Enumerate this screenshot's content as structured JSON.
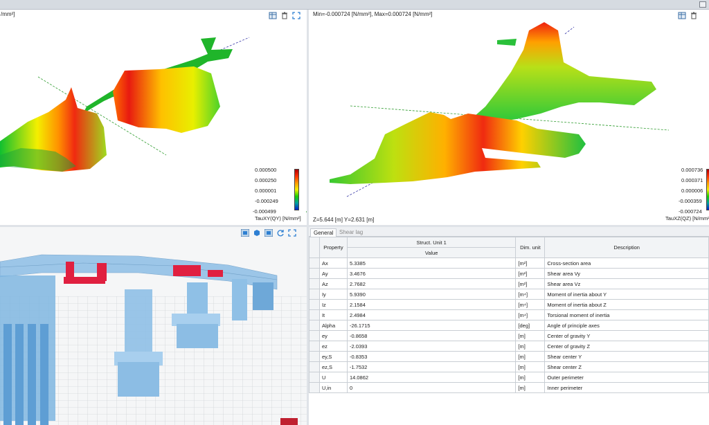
{
  "top_left": {
    "header_partial": "/mm²]",
    "legend": {
      "values": [
        "0.000500",
        "0.000250",
        "0.000001",
        "-0.000249",
        "-0.000499"
      ],
      "title": "TauXY(QY) [N/mm²]"
    }
  },
  "top_right": {
    "minmax": "Min=-0.000724 [N/mm²], Max=0.000724 [N/mm²]",
    "coords": "Z=5.644 [m] Y=2.631 [m]",
    "legend": {
      "values": [
        "0.000736",
        "0.000371",
        "0.000006",
        "-0.000359",
        "-0.000724"
      ],
      "title": "TauXZ(QZ) [N/mm²"
    }
  },
  "tabs": [
    "General",
    "Shear lag"
  ],
  "table": {
    "col_property": "Property",
    "col_unit_group": "Struct. Unit 1",
    "col_value": "Value",
    "col_dim": "Dim. unit",
    "col_desc": "Description",
    "rows": [
      {
        "p": "Ax",
        "v": "5.3385",
        "u": "[m²]",
        "d": "Cross-section area"
      },
      {
        "p": "Ay",
        "v": "3.4676",
        "u": "[m²]",
        "d": "Shear area Vy"
      },
      {
        "p": "Az",
        "v": "2.7682",
        "u": "[m²]",
        "d": "Shear area Vz"
      },
      {
        "p": "Iy",
        "v": "5.9390",
        "u": "[m⁴]",
        "d": "Moment of inertia about Y"
      },
      {
        "p": "Iz",
        "v": "2.1584",
        "u": "[m⁴]",
        "d": "Moment of inertia about Z"
      },
      {
        "p": "It",
        "v": "2.4984",
        "u": "[m⁴]",
        "d": "Torsional moment of inertia"
      },
      {
        "p": "Alpha",
        "v": "-26.1715",
        "u": "[deg]",
        "d": "Angle of principle axes"
      },
      {
        "p": "ey",
        "v": "-0.8658",
        "u": "[m]",
        "d": "Center of gravity Y"
      },
      {
        "p": "ez",
        "v": "-2.0393",
        "u": "[m]",
        "d": "Center of gravity Z"
      },
      {
        "p": "ey,S",
        "v": "-0.8353",
        "u": "[m]",
        "d": "Shear center Y"
      },
      {
        "p": "ez,S",
        "v": "-1.7532",
        "u": "[m]",
        "d": "Shear center Z"
      },
      {
        "p": "U",
        "v": "14.0862",
        "u": "[m]",
        "d": "Outer perimeter"
      },
      {
        "p": "U,in",
        "v": "0",
        "u": "[m]",
        "d": "Inner perimeter"
      }
    ]
  }
}
